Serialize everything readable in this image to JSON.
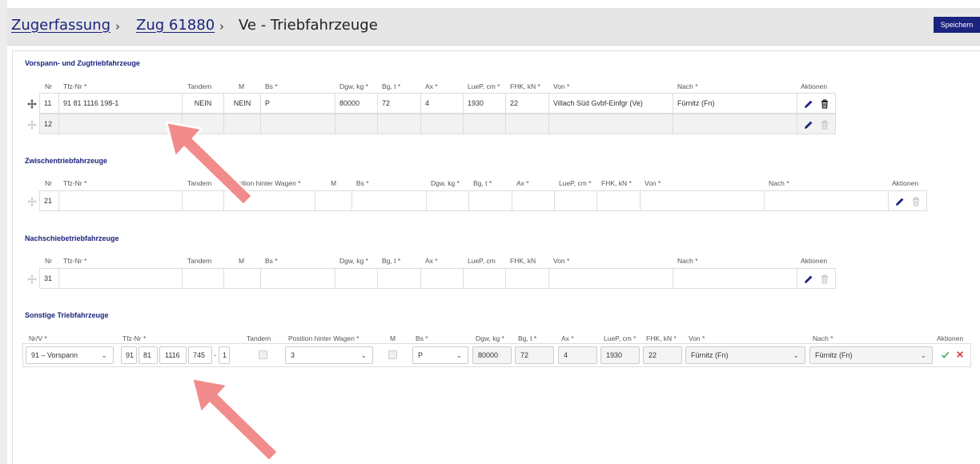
{
  "breadcrumb": {
    "link1": "Zugerfassung",
    "link2": "Zug 61880",
    "current": "Ve - Triebfahrzeuge",
    "separator": "›"
  },
  "toolbar": {
    "save_label": "Speichern"
  },
  "icons": {
    "move": "move-icon",
    "edit": "pencil-icon",
    "delete": "trash-icon",
    "confirm": "check-icon",
    "cancel": "close-icon",
    "dropdown": "chevron-down-icon"
  },
  "colors": {
    "accent": "#1a237e",
    "confirm": "#2e9e4f",
    "cancel": "#d32f2f",
    "arrow": "#f28b8b"
  },
  "sec1": {
    "title": "Vorspann- und Zugtriebfahrzeuge",
    "headers": {
      "nr": "Nr",
      "tfz": "Tfz-Nr *",
      "tandem": "Tandem",
      "m": "M",
      "bs": "Bs *",
      "dgw": "Dgw, kg *",
      "bg": "Bg, t *",
      "ax": "Ax *",
      "luep": "LueP, cm *",
      "fhk": "FHK, kN *",
      "von": "Von *",
      "nach": "Nach *",
      "aktionen": "Aktionen"
    },
    "rows": [
      {
        "nr": "11",
        "tfz": "91 81 1116 198-1",
        "tandem": "NEIN",
        "m": "NEIN",
        "bs": "P",
        "dgw": "80000",
        "bg": "72",
        "ax": "4",
        "luep": "1930",
        "fhk": "22",
        "von": "Villach Süd Gvbf-Einfgr (Ve)",
        "nach": "Fürnitz (Fn)"
      },
      {
        "nr": "12",
        "tfz": "",
        "tandem": "",
        "m": "",
        "bs": "",
        "dgw": "",
        "bg": "",
        "ax": "",
        "luep": "",
        "fhk": "",
        "von": "",
        "nach": ""
      }
    ]
  },
  "sec2": {
    "title": "Zwischentriebfahrzeuge",
    "headers": {
      "nr": "Nr",
      "tfz": "Tfz-Nr *",
      "tandem": "Tandem",
      "pos": "Position hinter Wagen *",
      "m": "M",
      "bs": "Bs *",
      "dgw": "Dgw, kg *",
      "bg": "Bg, t *",
      "ax": "Ax *",
      "luep": "LueP, cm *",
      "fhk": "FHK, kN *",
      "von": "Von *",
      "nach": "Nach *",
      "aktionen": "Aktionen"
    },
    "rows": [
      {
        "nr": "21"
      }
    ]
  },
  "sec3": {
    "title": "Nachschiebetriebfahrzeuge",
    "headers": {
      "nr": "Nr",
      "tfz": "Tfz-Nr *",
      "tandem": "Tandem",
      "m": "M",
      "bs": "Bs *",
      "dgw": "Dgw, kg *",
      "bg": "Bg, t *",
      "ax": "Ax *",
      "luep": "LueP, cm",
      "fhk": "FHK, kN",
      "von": "Von *",
      "nach": "Nach *",
      "aktionen": "Aktionen"
    },
    "rows": [
      {
        "nr": "31"
      }
    ]
  },
  "sec4": {
    "title": "Sonstige Triebfahrzeuge",
    "headers": {
      "nrv": "Nr/V *",
      "tfz": "Tfz-Nr *",
      "tandem": "Tandem",
      "pos": "Position hinter Wagen *",
      "m": "M",
      "bs": "Bs *",
      "dgw": "Dgw, kg *",
      "bg": "Bg, t *",
      "ax": "Ax *",
      "luep": "LueP, cm *",
      "fhk": "FHK, kN *",
      "von": "Von *",
      "nach": "Nach *",
      "aktionen": "Aktionen"
    },
    "form": {
      "nrv": "91 – Vorspann",
      "tfz1": "91",
      "tfz2": "81",
      "tfz3": "1116",
      "tfz4": "745",
      "tfz5": "1",
      "tfz_sep": "-",
      "position": "3",
      "bs": "P",
      "dgw": "80000",
      "bg": "72",
      "ax": "4",
      "luep": "1930",
      "fhk": "22",
      "von": "Fürnitz (Fn)",
      "nach": "Fürnitz (Fn)"
    }
  }
}
